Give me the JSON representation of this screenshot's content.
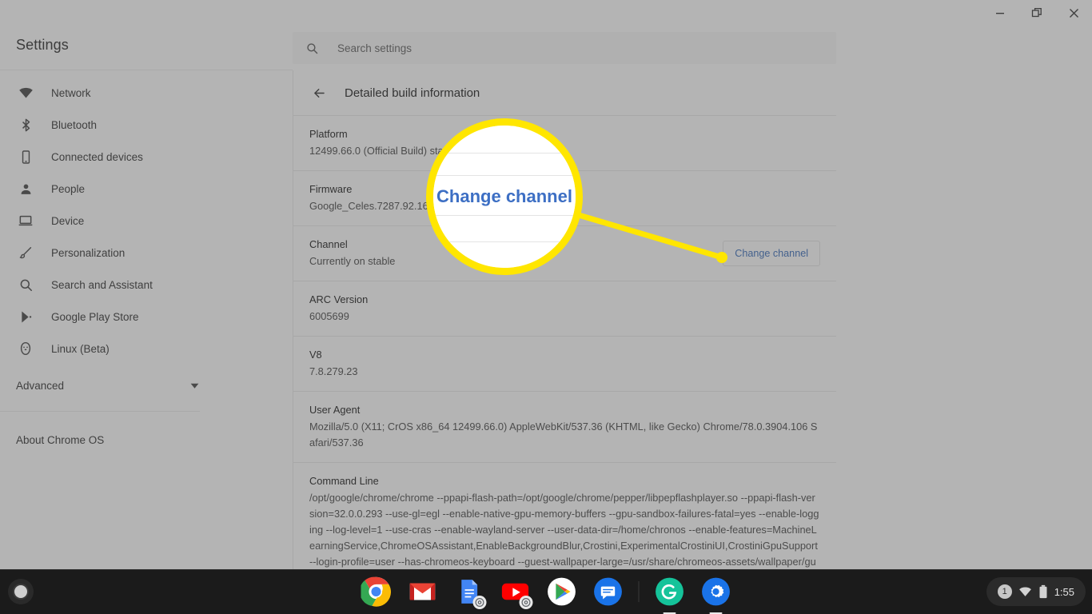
{
  "window": {
    "controls": [
      {
        "name": "minimize",
        "glyph": "minimize-icon"
      },
      {
        "name": "restore",
        "glyph": "restore-icon"
      },
      {
        "name": "close",
        "glyph": "close-icon"
      }
    ]
  },
  "sidebar": {
    "title": "Settings",
    "items": [
      {
        "label": "Network",
        "icon": "wifi-icon"
      },
      {
        "label": "Bluetooth",
        "icon": "bluetooth-icon"
      },
      {
        "label": "Connected devices",
        "icon": "phone-icon"
      },
      {
        "label": "People",
        "icon": "person-icon"
      },
      {
        "label": "Device",
        "icon": "laptop-icon"
      },
      {
        "label": "Personalization",
        "icon": "brush-icon"
      },
      {
        "label": "Search and Assistant",
        "icon": "search-icon"
      },
      {
        "label": "Google Play Store",
        "icon": "play-store-icon"
      },
      {
        "label": "Linux (Beta)",
        "icon": "linux-penguin-icon"
      }
    ],
    "advanced_label": "Advanced",
    "about_label": "About Chrome OS"
  },
  "search": {
    "placeholder": "Search settings",
    "value": "",
    "icon": "search-icon"
  },
  "main": {
    "back_icon": "back-arrow-icon",
    "title": "Detailed build information",
    "rows": [
      {
        "label": "Platform",
        "value": "12499.66.0 (Official Build) stable-channel celes",
        "action": null
      },
      {
        "label": "Firmware",
        "value": "Google_Celes.7287.92.164",
        "action": null
      },
      {
        "label": "Channel",
        "value": "Currently on stable",
        "action": "Change channel"
      },
      {
        "label": "ARC Version",
        "value": "6005699",
        "action": null
      },
      {
        "label": "V8",
        "value": "7.8.279.23",
        "action": null
      },
      {
        "label": "User Agent",
        "value": "Mozilla/5.0 (X11; CrOS x86_64 12499.66.0) AppleWebKit/537.36 (KHTML, like Gecko) Chrome/78.0.3904.106 Safari/537.36",
        "action": null
      },
      {
        "label": "Command Line",
        "value": "/opt/google/chrome/chrome --ppapi-flash-path=/opt/google/chrome/pepper/libpepflashplayer.so --ppapi-flash-version=32.0.0.293 --use-gl=egl --enable-native-gpu-memory-buffers --gpu-sandbox-failures-fatal=yes --enable-logging --log-level=1 --use-cras --enable-wayland-server --user-data-dir=/home/chronos --enable-features=MachineLearningService,ChromeOSAssistant,EnableBackgroundBlur,Crostini,ExperimentalCrostiniUI,CrostiniGpuSupport --login-profile=user --has-chromeos-keyboard --guest-wallpaper-large=/usr/share/chromeos-assets/wallpaper/guest_large.jpg --guest-wallpaper-small=/usr/share/chromeos-assets/wallpaper/guest_small.jpg --child-wallpaper-large=/usr/share/chromeos-assets/wallpaper/child_large.jpg",
        "action": null
      }
    ]
  },
  "callout": {
    "magnified_text": "Change channel",
    "ring_color": "#ffe600",
    "text_color": "#3d6fc4"
  },
  "shelf": {
    "launcher": "launcher-button",
    "apps": [
      {
        "name": "chrome",
        "label": "Chrome"
      },
      {
        "name": "gmail",
        "label": "Gmail"
      },
      {
        "name": "docs",
        "label": "Google Docs"
      },
      {
        "name": "youtube",
        "label": "YouTube"
      },
      {
        "name": "play-store",
        "label": "Play Store"
      },
      {
        "name": "messages",
        "label": "Messages"
      },
      {
        "name": "grammarly",
        "label": "Grammarly"
      },
      {
        "name": "settings",
        "label": "Settings"
      }
    ],
    "tray": {
      "badge": "1",
      "wifi_icon": "wifi-icon",
      "battery_icon": "battery-icon",
      "time": "1:55"
    }
  }
}
